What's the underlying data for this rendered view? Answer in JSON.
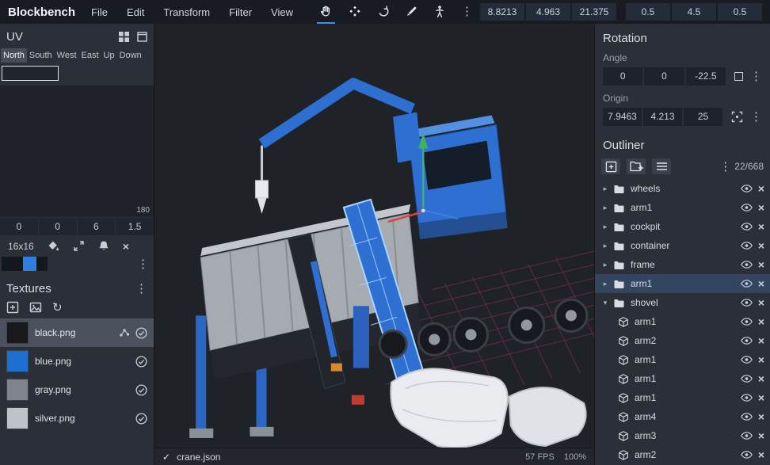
{
  "app_title": "Blockbench",
  "colors": {
    "accent": "#3e8ef6",
    "model_blue": "#2e6fd2",
    "selection_row": "#34465f"
  },
  "menubar": {
    "menus": [
      "File",
      "Edit",
      "Transform",
      "Filter",
      "View"
    ],
    "tool_icons": [
      "hand-icon",
      "vertices-icon",
      "rotate-icon",
      "brush-icon",
      "pose-icon",
      "kebab-icon"
    ],
    "position_fields": [
      "8.8213",
      "4.963",
      "21.375"
    ],
    "pivot_fields": [
      "0.5",
      "4.5",
      "0.5"
    ]
  },
  "uv_panel": {
    "title": "UV",
    "header_icons": [
      "grid-icon",
      "window-icon"
    ],
    "tabs": [
      "North",
      "South",
      "West",
      "East",
      "Up",
      "Down"
    ],
    "selected_tab": "North",
    "coord_input_value": "",
    "preview_scale_label": "180",
    "uv_fields": [
      "0",
      "0",
      "6",
      "1.5"
    ],
    "resolution_label": "16x16",
    "tool_icons": [
      "fill-bucket-icon",
      "expand-icon",
      "alert-icon",
      "close-icon"
    ]
  },
  "textures_panel": {
    "title": "Textures",
    "toolbar_icons": [
      "add-texture-icon",
      "import-texture-icon",
      "reload-icon"
    ],
    "items": [
      {
        "name": "black.png",
        "color": "#17191d",
        "selected": true
      },
      {
        "name": "blue.png",
        "color": "#1d6fd2",
        "selected": false
      },
      {
        "name": "gray.png",
        "color": "#80858d",
        "selected": false
      },
      {
        "name": "silver.png",
        "color": "#bfc3c9",
        "selected": false
      }
    ]
  },
  "viewport": {
    "status_file": "crane.json",
    "fps": "57 FPS",
    "zoom": "100%"
  },
  "rotation_panel": {
    "title": "Rotation",
    "angle_label": "Angle",
    "angle_values": [
      "0",
      "0",
      "-22.5"
    ],
    "origin_label": "Origin",
    "origin_values": [
      "7.9463",
      "4.213",
      "25"
    ]
  },
  "outliner_panel": {
    "title": "Outliner",
    "counter": "22/668",
    "items": [
      {
        "label": "wheels",
        "type": "group",
        "caret": "▸"
      },
      {
        "label": "arm1",
        "type": "group",
        "caret": "▸"
      },
      {
        "label": "cockpit",
        "type": "group",
        "caret": "▸"
      },
      {
        "label": "container",
        "type": "group",
        "caret": "▸"
      },
      {
        "label": "frame",
        "type": "group",
        "caret": "▸"
      },
      {
        "label": "arm1",
        "type": "group",
        "caret": "▸",
        "selected": true
      },
      {
        "label": "shovel",
        "type": "group",
        "caret": "▾",
        "expanded": true
      },
      {
        "label": "arm1",
        "type": "cube"
      },
      {
        "label": "arm2",
        "type": "cube"
      },
      {
        "label": "arm1",
        "type": "cube"
      },
      {
        "label": "arm1",
        "type": "cube"
      },
      {
        "label": "arm1",
        "type": "cube"
      },
      {
        "label": "arm4",
        "type": "cube"
      },
      {
        "label": "arm3",
        "type": "cube"
      },
      {
        "label": "arm2",
        "type": "cube"
      }
    ]
  }
}
